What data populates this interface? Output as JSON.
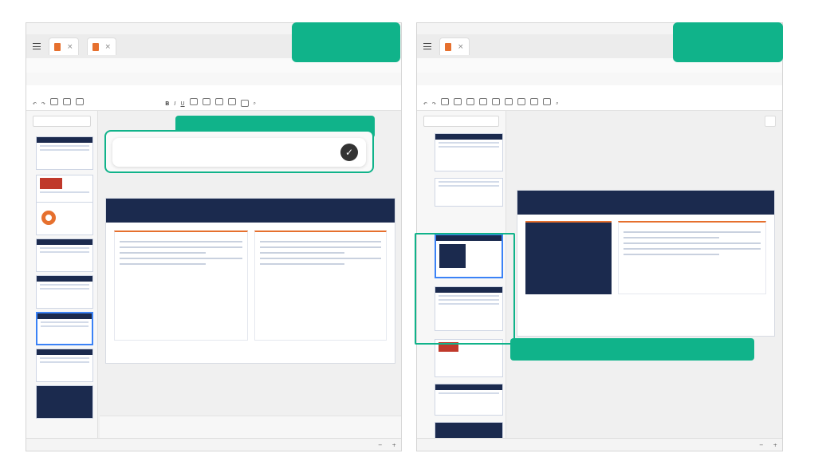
{
  "labels": {
    "before": "",
    "after": "",
    "step1": "",
    "step2": ""
  },
  "left": {
    "app_name": "",
    "menu_1": "",
    "menu_2": "",
    "menu_3": "",
    "tab1": "",
    "tab2": "",
    "filename": "",
    "ribbon_tabs": [
      "",
      "",
      "",
      "",
      "",
      "",
      "",
      ""
    ],
    "ribbon_buttons": [
      "",
      "",
      "",
      "",
      "",
      "",
      "",
      ""
    ],
    "add_page": "",
    "prompt_text": "",
    "slide_title": "",
    "slide_subtitle": "",
    "slide_number": "",
    "col1_heading": "",
    "col2_heading": "",
    "footer_left": "",
    "footer_right": "",
    "notes": "",
    "status": "",
    "zoom": "",
    "thumb_numbers": [
      "",
      "",
      "",
      "",
      "",
      "",
      "",
      ""
    ]
  },
  "right": {
    "tab1": "",
    "filename": "",
    "ribbon_tabs": [
      "",
      "",
      "",
      "",
      "",
      ""
    ],
    "ribbon_buttons": [
      "",
      "",
      "",
      "",
      "",
      "",
      "",
      "",
      ""
    ],
    "add_page": "",
    "mode": "",
    "slide_title": "",
    "slide_subtitle": "",
    "slide_number": "",
    "core_label": "",
    "core_text": "",
    "core_sub": "",
    "col_heading": "",
    "footer_left": "",
    "footer_right": "",
    "notes": "",
    "status": "",
    "zoom": "",
    "thumb_numbers": [
      "",
      "",
      "",
      "",
      ""
    ]
  },
  "colors": {
    "accent": "#10b38a",
    "navy": "#1b2a4e",
    "orange": "#e6702e",
    "select": "#3b82f6"
  }
}
